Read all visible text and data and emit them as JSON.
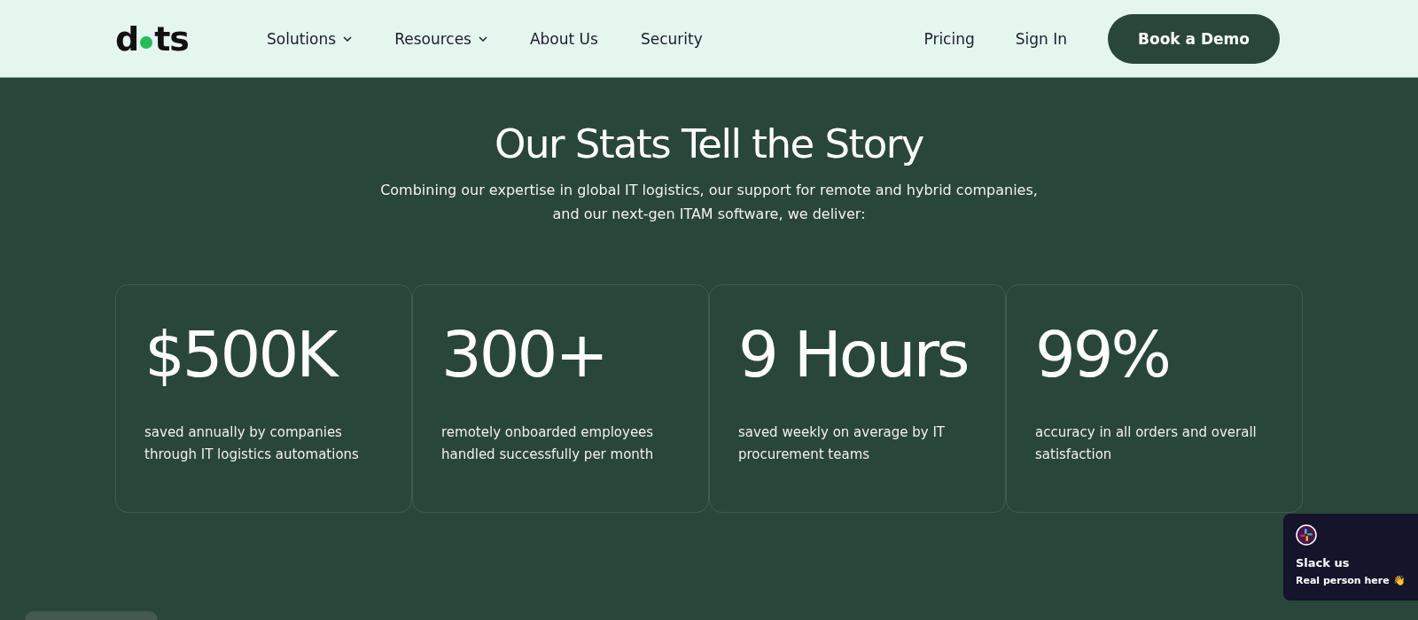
{
  "header": {
    "logo": {
      "left": "d",
      "right": "ts"
    },
    "nav": [
      {
        "label": "Solutions",
        "dropdown": true
      },
      {
        "label": "Resources",
        "dropdown": true
      },
      {
        "label": "About Us",
        "dropdown": false
      },
      {
        "label": "Security",
        "dropdown": false
      }
    ],
    "right_links": [
      "Pricing",
      "Sign In"
    ],
    "cta": "Book a Demo"
  },
  "hero": {
    "title": "Our Stats Tell the Story",
    "subtitle_lines": [
      "Combining our expertise in global IT logistics, our support for remote and hybrid companies,",
      "and our next-gen ITAM software, we deliver:"
    ]
  },
  "stats": [
    {
      "value": "$500K",
      "description_lines": [
        "saved annually by companies",
        "through IT logistics automations"
      ]
    },
    {
      "value": "300+",
      "description_lines": [
        "remotely onboarded employees",
        "handled successfully per month"
      ]
    },
    {
      "value": "9 Hours",
      "description_lines": [
        "saved weekly on average by IT",
        "procurement teams"
      ]
    },
    {
      "value": "99%",
      "description_lines": [
        "accuracy in all orders and overall",
        "satisfaction"
      ]
    }
  ],
  "chat_widget": {
    "title": "Slack us",
    "subtitle": "Real person here",
    "emoji": "👋"
  }
}
